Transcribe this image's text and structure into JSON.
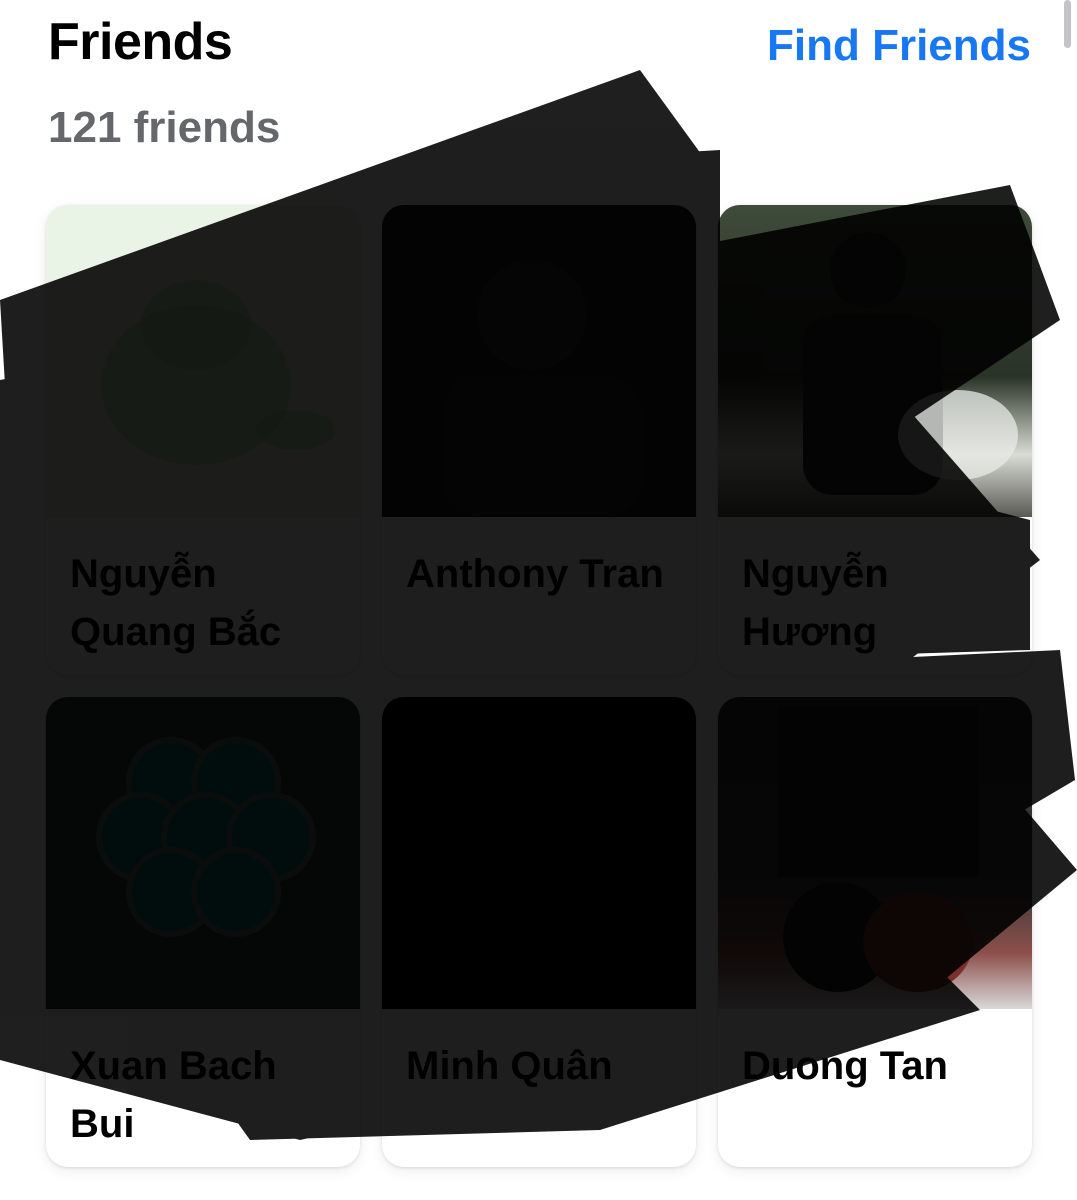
{
  "header": {
    "title": "Friends",
    "find_friends_label": "Find Friends",
    "friend_count": "121 friends"
  },
  "friends": [
    {
      "name": "Nguyễn Quang Bắc"
    },
    {
      "name": "Anthony Tran"
    },
    {
      "name": "Nguyễn Hương"
    },
    {
      "name": "Xuan Bach Bui"
    },
    {
      "name": "Minh Quân"
    },
    {
      "name": "Duong Tan"
    }
  ],
  "colors": {
    "accent": "#1877f2",
    "secondary_text": "#65676b"
  }
}
